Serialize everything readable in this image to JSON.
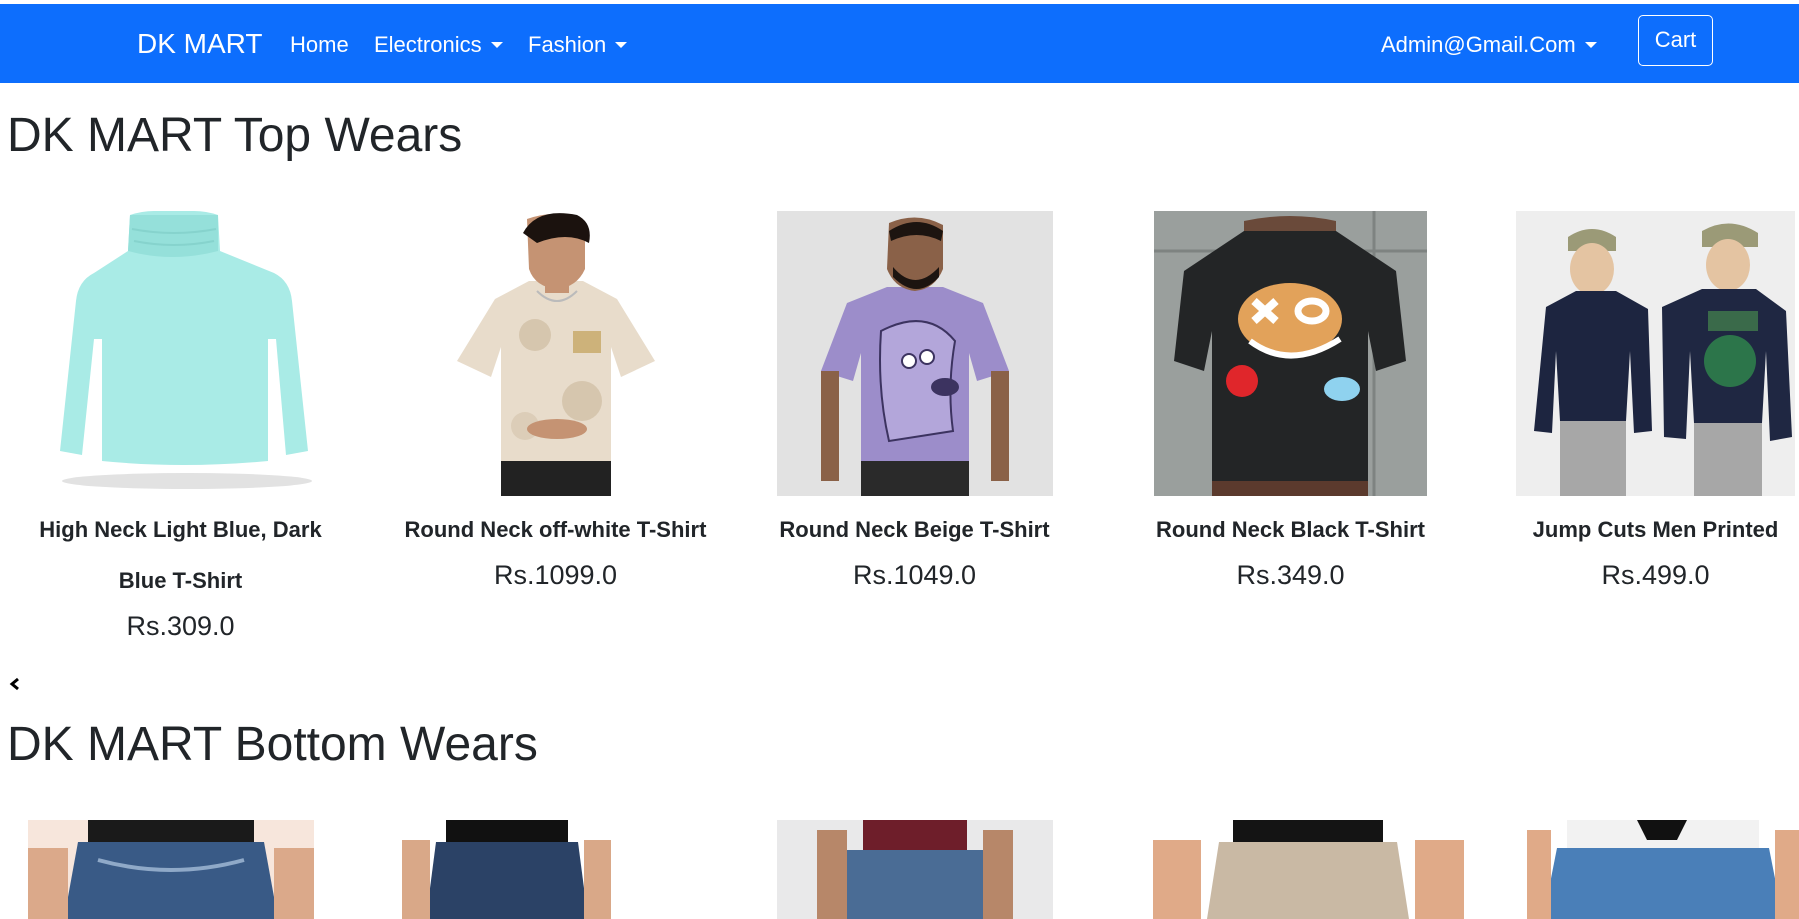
{
  "navbar": {
    "brand": "DK MART",
    "links": [
      {
        "label": "Home",
        "dropdown": false
      },
      {
        "label": "Electronics",
        "dropdown": true
      },
      {
        "label": "Fashion",
        "dropdown": true
      }
    ],
    "account": "Admin@Gmail.Com",
    "cart_label": "Cart",
    "color": "#0d6efd"
  },
  "sections": [
    {
      "title": "DK MART Top Wears",
      "products": [
        {
          "name": "High Neck Light Blue, Dark Blue T-Shirt",
          "price": "Rs.309.0"
        },
        {
          "name": "Round Neck off-white T-Shirt",
          "price": "Rs.1099.0"
        },
        {
          "name": "Round Neck Beige T-Shirt",
          "price": "Rs.1049.0"
        },
        {
          "name": "Round Neck Black T-Shirt",
          "price": "Rs.349.0"
        },
        {
          "name": "Jump Cuts Men Printed",
          "price": "Rs.499.0"
        }
      ],
      "prev_icon": "chevron-left-icon"
    },
    {
      "title": "DK MART Bottom Wears"
    }
  ]
}
